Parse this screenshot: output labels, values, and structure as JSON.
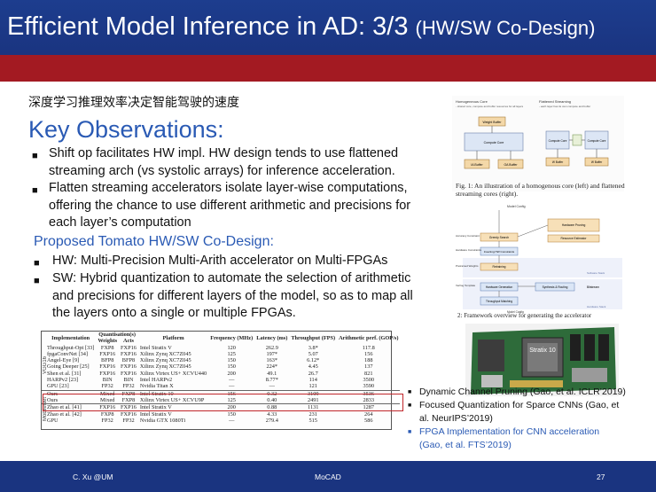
{
  "header": {
    "title": "Efficient Model Inference in AD: 3/3",
    "subtitle": "(HW/SW Co-Design)"
  },
  "chinese_heading": "深度学习推理效率决定智能驾驶的速度",
  "key_observations": {
    "heading": "Key Observations:",
    "bullets": [
      {
        "lines": [
          "Shift op facilitates HW impl. HW design tends to use  flattened",
          "streaming arch (vs systolic arrays) for inference acceleration."
        ]
      },
      {
        "lines": [
          "Flatten streaming accelerators isolate layer-wise computations,",
          "offering the chance to use different arithmetic and precisions for",
          "each layer’s computation"
        ]
      }
    ]
  },
  "proposed": {
    "heading": "Proposed Tomato HW/SW Co-Design:",
    "bullets": [
      {
        "lines": [
          "HW: Multi-Precision Multi-Arith accelerator on Multi-FPGAs"
        ]
      },
      {
        "lines": [
          "SW:  Hybrid quantization to automate the selection of arithmetic",
          "and precisions for different layers of the model, so as to map all",
          "the layers onto a single or multiple FPGAs."
        ]
      }
    ]
  },
  "table": {
    "group_header": "Quantisation(s)",
    "columns": [
      "Implementation",
      "Weights",
      "Acts",
      "Platform",
      "Frequency (MHz)",
      "Latency (ms)",
      "Throughput (FPS)",
      "Arithmetic perf. (GOP/s)"
    ],
    "side_labels": [
      "VGG16",
      "MobileNet"
    ],
    "rows": [
      [
        "Throughput-Opt [33]",
        "FXP8",
        "FXP16",
        "Intel Stratix V",
        "120",
        "262.9",
        "3.8*",
        "117.8"
      ],
      [
        "fpgaConvNet [34]",
        "FXP16",
        "FXP16",
        "Xilinx Zynq XC7Z045",
        "125",
        "197*",
        "5.07",
        "156"
      ],
      [
        "Angel-Eye [9]",
        "BFP8",
        "BFP8",
        "Xilinx Zynq XC7Z045",
        "150",
        "163*",
        "6.12*",
        "188"
      ],
      [
        "Going Deeper [25]",
        "FXP16",
        "FXP16",
        "Xilinx Zynq XC7Z045",
        "150",
        "224*",
        "4.45",
        "137"
      ],
      [
        "Shen et al. [31]",
        "FXP16",
        "FXP16",
        "Xilinx Virtex US+ XCVU440",
        "200",
        "49.1",
        "26.7",
        "821"
      ],
      [
        "HARPv2 [23]",
        "BIN",
        "BIN",
        "Intel HARPv2",
        "—",
        "8.77*",
        "114",
        "3500"
      ],
      [
        "GPU [23]",
        "FP32",
        "FP32",
        "Nvidia Titan X",
        "—",
        "—",
        "121",
        "3590"
      ],
      [
        "Ours",
        "Mixed",
        "FXP8",
        "Intel Stratix 10",
        "156",
        "0.32",
        "3109",
        "3536"
      ],
      [
        "Ours",
        "Mixed",
        "FXP8",
        "Xilinx Virtex US+ XCVU9P",
        "125",
        "0.40",
        "2491",
        "2833"
      ],
      [
        "Zhao et al. [41]",
        "FXP16",
        "FXP16",
        "Intel Stratix V",
        "200",
        "0.88",
        "1131",
        "1287"
      ],
      [
        "Zhao et al. [42]",
        "FXP8",
        "FXP16",
        "Intel Stratix V",
        "150",
        "4.33",
        "231",
        "264"
      ],
      [
        "GPU",
        "FP32",
        "FP32",
        "Nvidia GTX 1080Ti",
        "—",
        "279.4",
        "515",
        "586"
      ]
    ]
  },
  "figure1": {
    "caption": "Fig. 1:  An illustration of a homogenous core (left) and flattened streaming cores (right).",
    "left_title": "Homogeneous Core",
    "left_sub": "- shared core, compute and buffer resources for all layers",
    "right_title": "Flattened Streaming",
    "right_sub": "- each layer has its own compute and buffer",
    "blocks": [
      "Weight Buffer",
      "Compute Core",
      "IA Buffer",
      "OA Buffer",
      "Compute Core",
      "Compute Core",
      "W Buffer",
      "W Buffer"
    ]
  },
  "figure2": {
    "caption": "2: Framework overview for generating the accelerator",
    "blocks": [
      "Model Config",
      "Greedy Search",
      "Hardware Pruning",
      "Resource Estimator",
      "Inserting HW Constraints",
      "Retraining",
      "Hardware Generation",
      "Synthesis & Routing",
      "Bitstream",
      "Throughput Matching",
      "Model Config"
    ],
    "labels": [
      "Accuracy Constraint",
      "Hardware Constraints",
      "Pretrained Weights",
      "Verilog Template",
      "Software Stack",
      "Hardware Stack"
    ]
  },
  "board": {
    "chip_label": "Stratix 10"
  },
  "references": [
    {
      "text": "Dynamic Channel Pruning (Gao, et al. ICLR’2019)",
      "lines": [
        "Dynamic Channel Pruning (Gao, et al. ICLR’2019)"
      ],
      "blue": false
    },
    {
      "text": "Focused Quantization for Sparce CNNs (Gao, et al. NeurIPS’2019)",
      "lines": [
        "Focused Quantization for Sparce CNNs (Gao, et",
        "al. NeurIPS’2019)"
      ],
      "blue": false
    },
    {
      "text": "FPGA Implementation for CNN acceleration (Gao, et al. FTS’2019)",
      "lines": [
        "FPGA Implementation for CNN acceleration",
        "(Gao, et al. FTS’2019)"
      ],
      "blue": true
    }
  ],
  "footer": {
    "left": "C. Xu @UM",
    "center": "MoCAD",
    "page": "27"
  },
  "colors": {
    "header_blue": "#1d3d8e",
    "accent_red": "#a31a22",
    "heading_blue": "#2a5ab4",
    "highlight_box": "#c0262a"
  }
}
